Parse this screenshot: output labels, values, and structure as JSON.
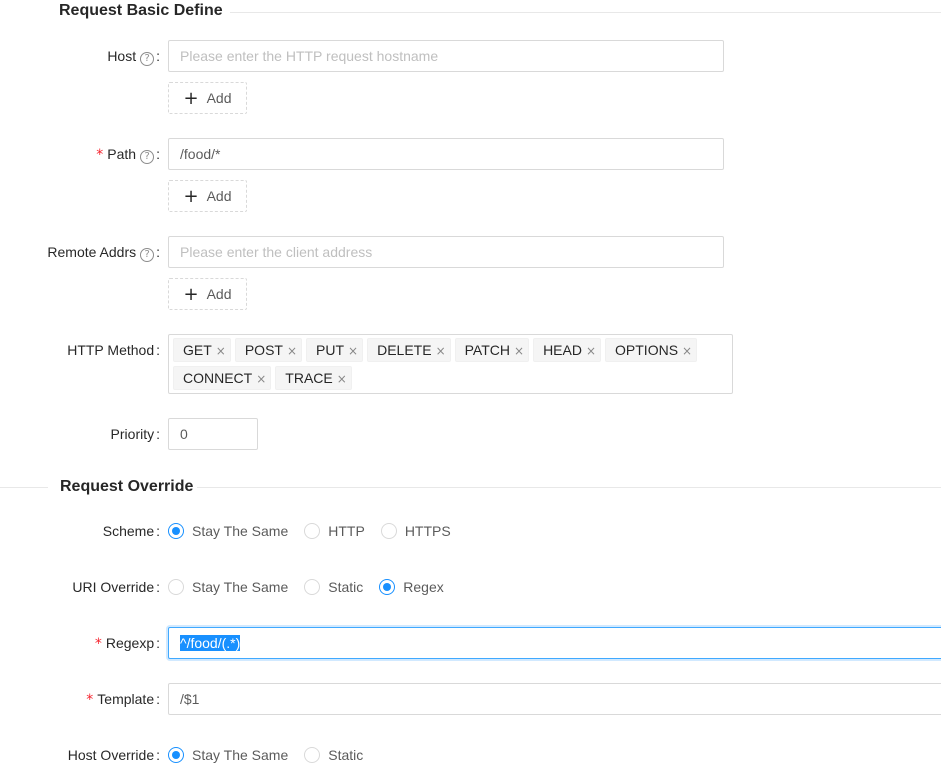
{
  "request_basic": {
    "title": "Request Basic Define",
    "host": {
      "label": "Host",
      "placeholder": "Please enter the HTTP request hostname",
      "add_label": "Add"
    },
    "path": {
      "label": "Path",
      "value": "/food/*",
      "add_label": "Add"
    },
    "remote_addrs": {
      "label": "Remote Addrs",
      "placeholder": "Please enter the client address",
      "add_label": "Add"
    },
    "http_method": {
      "label": "HTTP Method",
      "tags": [
        "GET",
        "POST",
        "PUT",
        "DELETE",
        "PATCH",
        "HEAD",
        "OPTIONS",
        "CONNECT",
        "TRACE"
      ]
    },
    "priority": {
      "label": "Priority",
      "value": "0"
    }
  },
  "request_override": {
    "title": "Request Override",
    "scheme": {
      "label": "Scheme",
      "options": [
        "Stay The Same",
        "HTTP",
        "HTTPS"
      ],
      "selected": "Stay The Same"
    },
    "uri_override": {
      "label": "URI Override",
      "options": [
        "Stay The Same",
        "Static",
        "Regex"
      ],
      "selected": "Regex"
    },
    "regexp": {
      "label": "Regexp",
      "value": "^/food/(.*)"
    },
    "template": {
      "label": "Template",
      "value": "/$1"
    },
    "host_override": {
      "label": "Host Override",
      "options": [
        "Stay The Same",
        "Static"
      ],
      "selected": "Stay The Same"
    }
  },
  "common": {
    "colon": ":",
    "help_glyph": "?",
    "required_mark": "*",
    "tag_close": "×",
    "add_glyph": "+"
  },
  "colors": {
    "primary": "#1890ff",
    "required": "#f5222d",
    "border": "#d9d9d9"
  }
}
